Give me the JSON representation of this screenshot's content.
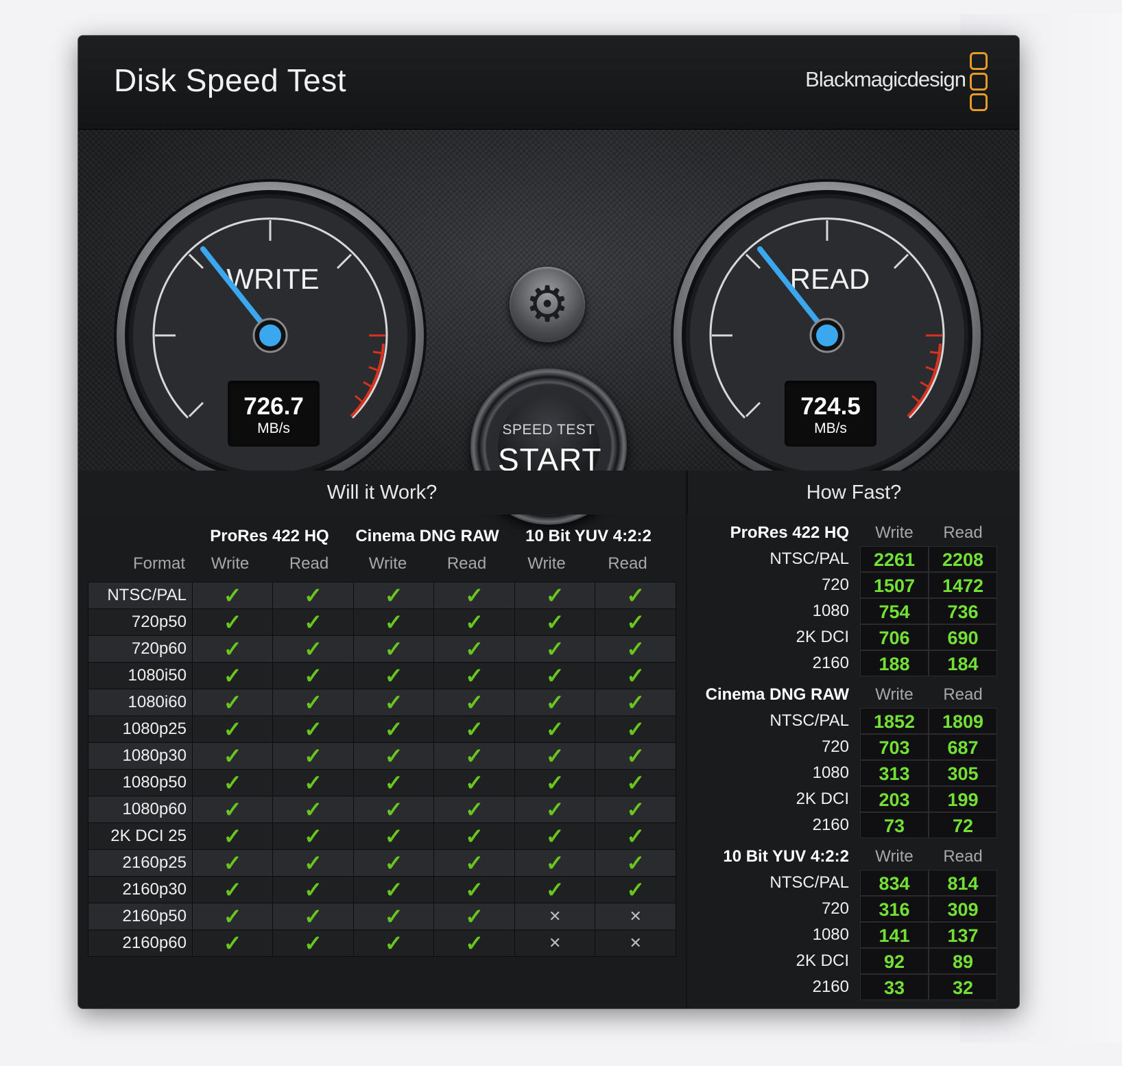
{
  "window": {
    "close_symbol": "×",
    "title": "Disk Speed Test",
    "brand": "Blackmagicdesign"
  },
  "colors": {
    "accent_blue": "#3aa7ee",
    "value_green": "#72e034",
    "check_green": "#68c61f",
    "brand_orange": "#e69a28",
    "redline": "#d8331e"
  },
  "gauges": {
    "write": {
      "label": "WRITE",
      "value": "726.7",
      "unit": "MB/s"
    },
    "read": {
      "label": "READ",
      "value": "724.5",
      "unit": "MB/s"
    }
  },
  "controls": {
    "settings_icon": "gear-icon",
    "start_sub": "SPEED TEST",
    "start_main": "START"
  },
  "will_it_work": {
    "heading": "Will it Work?",
    "format_header": "Format",
    "groups": [
      "ProRes 422 HQ",
      "Cinema DNG RAW",
      "10 Bit YUV 4:2:2"
    ],
    "subcols": [
      "Write",
      "Read",
      "Write",
      "Read",
      "Write",
      "Read"
    ],
    "rows": [
      {
        "format": "NTSC/PAL",
        "ok": [
          true,
          true,
          true,
          true,
          true,
          true
        ]
      },
      {
        "format": "720p50",
        "ok": [
          true,
          true,
          true,
          true,
          true,
          true
        ]
      },
      {
        "format": "720p60",
        "ok": [
          true,
          true,
          true,
          true,
          true,
          true
        ]
      },
      {
        "format": "1080i50",
        "ok": [
          true,
          true,
          true,
          true,
          true,
          true
        ]
      },
      {
        "format": "1080i60",
        "ok": [
          true,
          true,
          true,
          true,
          true,
          true
        ]
      },
      {
        "format": "1080p25",
        "ok": [
          true,
          true,
          true,
          true,
          true,
          true
        ]
      },
      {
        "format": "1080p30",
        "ok": [
          true,
          true,
          true,
          true,
          true,
          true
        ]
      },
      {
        "format": "1080p50",
        "ok": [
          true,
          true,
          true,
          true,
          true,
          true
        ]
      },
      {
        "format": "1080p60",
        "ok": [
          true,
          true,
          true,
          true,
          true,
          true
        ]
      },
      {
        "format": "2K DCI 25",
        "ok": [
          true,
          true,
          true,
          true,
          true,
          true
        ]
      },
      {
        "format": "2160p25",
        "ok": [
          true,
          true,
          true,
          true,
          true,
          true
        ]
      },
      {
        "format": "2160p30",
        "ok": [
          true,
          true,
          true,
          true,
          true,
          true
        ]
      },
      {
        "format": "2160p50",
        "ok": [
          true,
          true,
          true,
          true,
          false,
          false
        ]
      },
      {
        "format": "2160p60",
        "ok": [
          true,
          true,
          true,
          true,
          false,
          false
        ]
      }
    ],
    "check_symbol": "✓",
    "cross_symbol": "✕"
  },
  "how_fast": {
    "heading": "How Fast?",
    "write_header": "Write",
    "read_header": "Read",
    "blocks": [
      {
        "title": "ProRes 422 HQ",
        "rows": [
          {
            "label": "NTSC/PAL",
            "write": "2261",
            "read": "2208"
          },
          {
            "label": "720",
            "write": "1507",
            "read": "1472"
          },
          {
            "label": "1080",
            "write": "754",
            "read": "736"
          },
          {
            "label": "2K DCI",
            "write": "706",
            "read": "690"
          },
          {
            "label": "2160",
            "write": "188",
            "read": "184"
          }
        ]
      },
      {
        "title": "Cinema DNG RAW",
        "rows": [
          {
            "label": "NTSC/PAL",
            "write": "1852",
            "read": "1809"
          },
          {
            "label": "720",
            "write": "703",
            "read": "687"
          },
          {
            "label": "1080",
            "write": "313",
            "read": "305"
          },
          {
            "label": "2K DCI",
            "write": "203",
            "read": "199"
          },
          {
            "label": "2160",
            "write": "73",
            "read": "72"
          }
        ]
      },
      {
        "title": "10 Bit YUV 4:2:2",
        "rows": [
          {
            "label": "NTSC/PAL",
            "write": "834",
            "read": "814"
          },
          {
            "label": "720",
            "write": "316",
            "read": "309"
          },
          {
            "label": "1080",
            "write": "141",
            "read": "137"
          },
          {
            "label": "2K DCI",
            "write": "92",
            "read": "89"
          },
          {
            "label": "2160",
            "write": "33",
            "read": "32"
          }
        ]
      }
    ]
  }
}
